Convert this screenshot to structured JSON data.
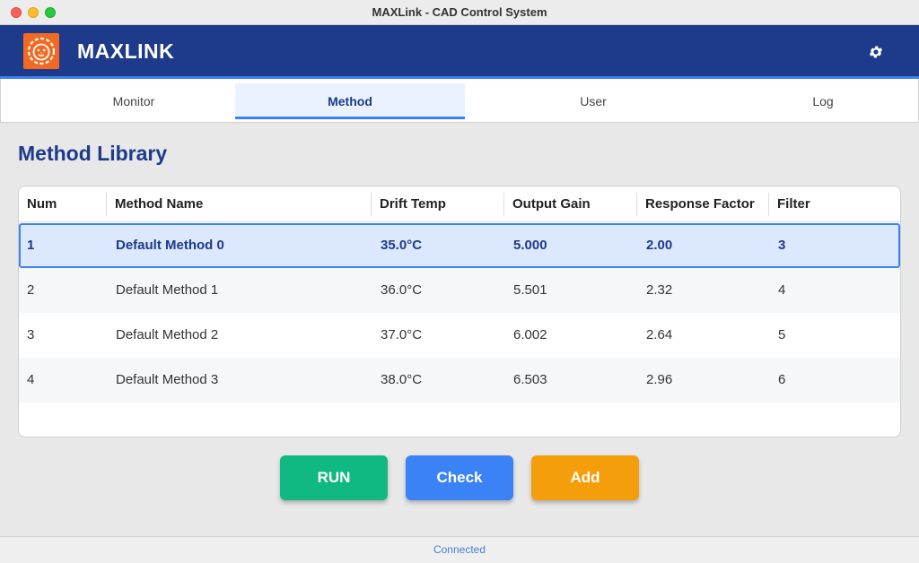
{
  "window": {
    "title": "MAXLink - CAD Control System"
  },
  "header": {
    "brand": "MAXLINK",
    "logo_icon": "lion-logo-icon",
    "settings_icon": "gear-icon"
  },
  "tabs": [
    {
      "label": "Monitor",
      "active": false
    },
    {
      "label": "Method",
      "active": true
    },
    {
      "label": "User",
      "active": false
    },
    {
      "label": "Log",
      "active": false
    }
  ],
  "main": {
    "title": "Method Library"
  },
  "table": {
    "columns": [
      "Num",
      "Method Name",
      "Drift Temp",
      "Output Gain",
      "Response Factor",
      "Filter"
    ],
    "rows": [
      [
        "1",
        "Default Method 0",
        "35.0°C",
        "5.000",
        "2.00",
        "3"
      ],
      [
        "2",
        "Default Method 1",
        "36.0°C",
        "5.501",
        "2.32",
        "4"
      ],
      [
        "3",
        "Default Method 2",
        "37.0°C",
        "6.002",
        "2.64",
        "5"
      ],
      [
        "4",
        "Default Method 3",
        "38.0°C",
        "6.503",
        "2.96",
        "6"
      ]
    ],
    "selected_row": 0
  },
  "buttons": {
    "run": "RUN",
    "check": "Check",
    "add": "Add"
  },
  "status": {
    "text": "Connected"
  },
  "colors": {
    "header": "#1e3a8a",
    "accent": "#3b82f6",
    "run": "#10b981",
    "check": "#3b82f6",
    "add": "#f59e0b",
    "logo": "#f26a21"
  }
}
